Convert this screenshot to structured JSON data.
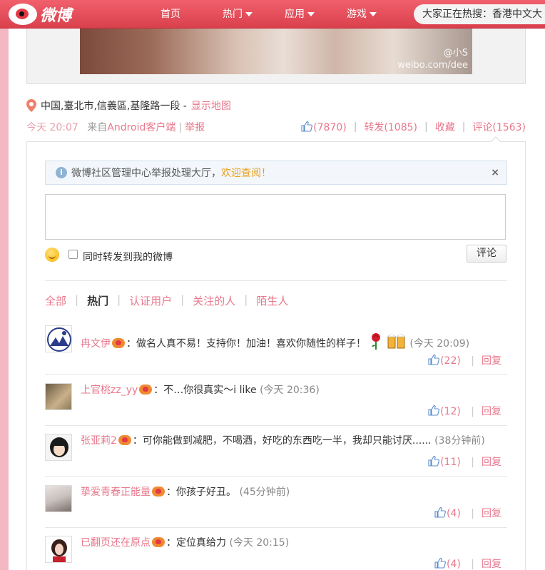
{
  "nav": {
    "logo_text": "微博",
    "home": "首页",
    "hot": "热门",
    "apps": "应用",
    "games": "游戏",
    "search_placeholder": "大家正在热搜：香港中文大"
  },
  "photo": {
    "watermark_user": "@小S",
    "watermark_url": "weibo.com/dee"
  },
  "post": {
    "location": "中国,臺北市,信義區,基隆路一段 -",
    "show_map": "显示地图",
    "time": "今天 20:07",
    "source_prefix": "来自",
    "source": "Android客户端",
    "report": "举报",
    "likes": "(7870)",
    "repost": "转发(1085)",
    "favorite": "收藏",
    "comment": "评论(1563)"
  },
  "compose": {
    "notice_text": "微博社区管理中心举报处理大厅，",
    "notice_link": "欢迎查阅！",
    "notice_close": "×",
    "repost_label": "同时转发到我的微博",
    "submit_label": "评论"
  },
  "filters": {
    "all": "全部",
    "hot": "热门",
    "verified": "认证用户",
    "following": "关注的人",
    "strangers": "陌生人"
  },
  "comments": [
    {
      "name": "冉文伊",
      "text": "：做名人真不易！支持你！加油！喜欢你随性的样子！",
      "time": "(今天 20:09)",
      "likes": "(22)",
      "reply": "回复"
    },
    {
      "name": "上官桃zz_yy",
      "text": "：不…你很真实～i like",
      "time": "(今天 20:36)",
      "likes": "(12)",
      "reply": "回复"
    },
    {
      "name": "张亚莉2",
      "text": "：可你能做到减肥，不喝酒，好吃的东西吃一半，我却只能讨厌......",
      "time": "(38分钟前)",
      "likes": "(11)",
      "reply": "回复"
    },
    {
      "name": "挚爱青春正能量",
      "text": "：你孩子好丑。",
      "time": "(45分钟前)",
      "likes": "(4)",
      "reply": "回复"
    },
    {
      "name": "已翻页还在原点",
      "text": "：定位真给力",
      "time": "(今天 20:15)",
      "likes": "(4)",
      "reply": "回复"
    }
  ],
  "colors": {
    "brand": "#e23a45",
    "link": "#e8778b",
    "notice_link": "#e8a020"
  }
}
